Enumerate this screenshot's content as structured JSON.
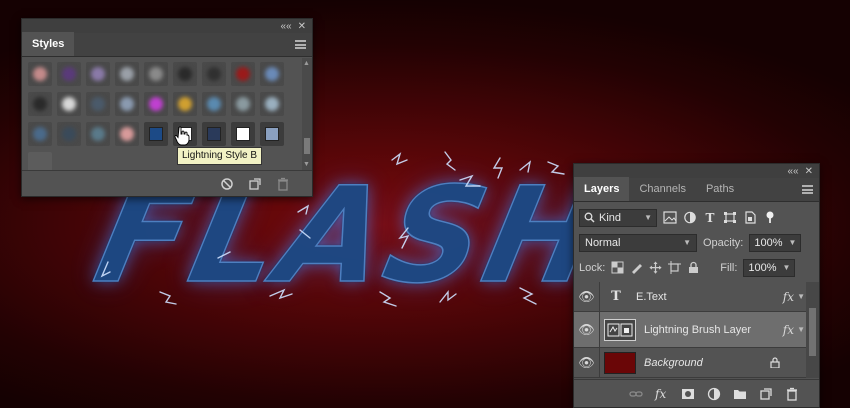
{
  "canvas": {
    "headline": "FLASH"
  },
  "styles_panel": {
    "tab": "Styles",
    "tooltip": "Lightning Style B",
    "collapse_glyph": "««",
    "close_glyph": "✕",
    "swatch_colors": [
      [
        "#c48a8a",
        "#5a3a7a",
        "#8a7aa8",
        "#9aa0a8",
        "#8a8a8a",
        "#2a2a2a",
        "#303030",
        "#9a1a1a",
        "#6a8ab8"
      ],
      [
        "#2a2a2a",
        "#d8d8d8",
        "#4a5a6a",
        "#8a9ab0",
        "#c040d0",
        "#d0a030",
        "#5a8ab0",
        "#8a9aa0",
        "#9ab0c0"
      ],
      [
        "#4a6a8a",
        "#3a4a5a",
        "#5a7a8a",
        "#d89a9a",
        "#1c4a86",
        "#ffffff",
        "#2a3a5a",
        "#ffffff",
        "#8aa0c0"
      ]
    ],
    "footer_icons": [
      "no-style-icon",
      "new-style-icon",
      "trash-icon"
    ]
  },
  "layers_panel": {
    "tabs": [
      "Layers",
      "Channels",
      "Paths"
    ],
    "active_tab": "Layers",
    "filter": {
      "kind_label": "Kind"
    },
    "blend_mode": "Normal",
    "opacity_label": "Opacity:",
    "opacity_value": "100%",
    "lock_label": "Lock:",
    "fill_label": "Fill:",
    "fill_value": "100%",
    "layers": [
      {
        "name": "E.Text",
        "type": "text",
        "has_fx": true,
        "fx_label": "fx",
        "selected": false
      },
      {
        "name": "Lightning Brush Layer",
        "type": "smart",
        "has_fx": true,
        "fx_label": "fx",
        "selected": true
      },
      {
        "name": "Background",
        "type": "background",
        "has_fx": false,
        "locked": true,
        "selected": false
      }
    ],
    "footer_icons": [
      "link-icon",
      "fx-icon",
      "mask-icon",
      "adjustment-icon",
      "group-folder-icon",
      "new-layer-icon",
      "trash-icon"
    ],
    "footer_fx": "fx"
  },
  "colors": {
    "panel_bg": "#535353",
    "tab_bar_bg": "#424242",
    "selected_layer": "#6e6e6e",
    "canvas_red": "#7a0a0c",
    "text_blue": "#1c4a86"
  }
}
